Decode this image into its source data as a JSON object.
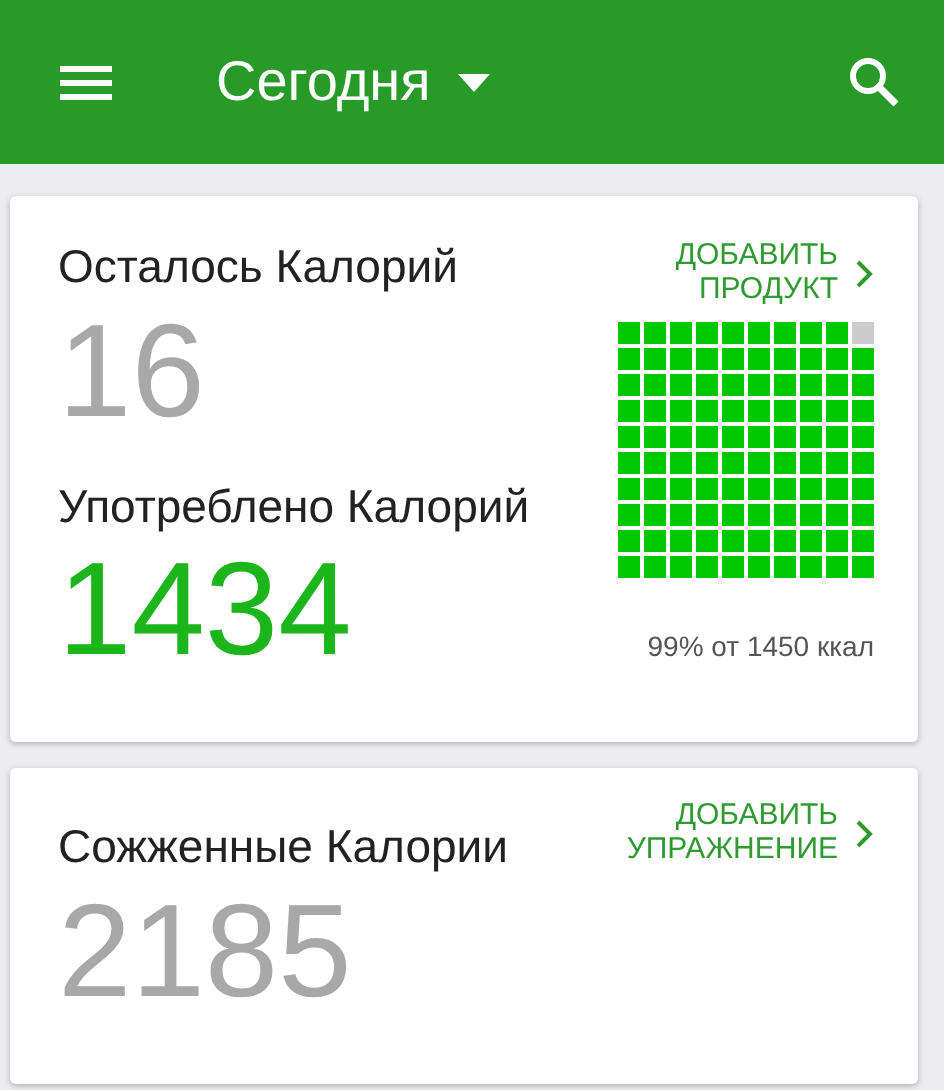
{
  "app_bar": {
    "title": "Сегодня"
  },
  "food_card": {
    "remaining_label": "Осталось Калорий",
    "remaining_value": "16",
    "consumed_label": "Употреблено Калорий",
    "consumed_value": "1434",
    "add_link": "ДОБАВИТЬ ПРОДУКТ",
    "percent_text": "99% от 1450 ккал"
  },
  "exercise_card": {
    "burned_label": "Сожженные Калории",
    "burned_value": "2185",
    "add_link": "ДОБАВИТЬ УПРАЖНЕНИЕ"
  }
}
